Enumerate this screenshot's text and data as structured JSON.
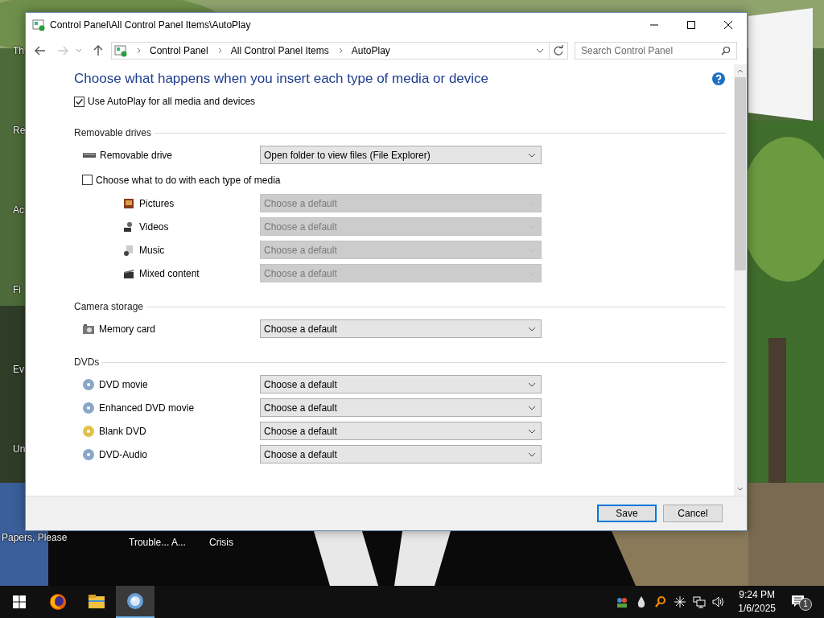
{
  "desktop_icons": [
    {
      "label": "Th"
    },
    {
      "label": "Re"
    },
    {
      "label": "Ac"
    },
    {
      "label": "Fi"
    },
    {
      "label": "Ev"
    },
    {
      "label": "Un"
    },
    {
      "label": "Papers, Please"
    },
    {
      "label": "Trouble... A..."
    },
    {
      "label": "Crisis"
    }
  ],
  "window": {
    "title": "Control Panel\\All Control Panel Items\\AutoPlay"
  },
  "address_bar": {
    "breadcrumbs": [
      "Control Panel",
      "All Control Panel Items",
      "AutoPlay"
    ]
  },
  "search": {
    "placeholder": "Search Control Panel"
  },
  "heading": "Choose what happens when you insert each type of media or device",
  "use_autoplay": {
    "label": "Use AutoPlay for all media and devices",
    "checked": true
  },
  "sections": [
    {
      "title": "Removable drives",
      "items": [
        {
          "kind": "select",
          "label": "Removable drive",
          "value": "Open folder to view files (File Explorer)",
          "disabled": false
        },
        {
          "kind": "checkbox",
          "label": "Choose what to do with each type of media",
          "checked": false,
          "children": [
            {
              "kind": "select",
              "label": "Pictures",
              "value": "Choose a default",
              "disabled": true
            },
            {
              "kind": "select",
              "label": "Videos",
              "value": "Choose a default",
              "disabled": true
            },
            {
              "kind": "select",
              "label": "Music",
              "value": "Choose a default",
              "disabled": true
            },
            {
              "kind": "select",
              "label": "Mixed content",
              "value": "Choose a default",
              "disabled": true
            }
          ]
        }
      ]
    },
    {
      "title": "Camera storage",
      "items": [
        {
          "kind": "select",
          "label": "Memory card",
          "value": "Choose a default",
          "disabled": false
        }
      ]
    },
    {
      "title": "DVDs",
      "items": [
        {
          "kind": "select",
          "label": "DVD movie",
          "value": "Choose a default",
          "disabled": false
        },
        {
          "kind": "select",
          "label": "Enhanced DVD movie",
          "value": "Choose a default",
          "disabled": false
        },
        {
          "kind": "select",
          "label": "Blank DVD",
          "value": "Choose a default",
          "disabled": false
        },
        {
          "kind": "select",
          "label": "DVD-Audio",
          "value": "Choose a default",
          "disabled": false
        }
      ]
    }
  ],
  "buttons": [
    {
      "label": "Save",
      "default": true
    },
    {
      "label": "Cancel",
      "default": false
    }
  ],
  "taskbar": {
    "apps": [
      {
        "selected": false
      },
      {
        "selected": false
      },
      {
        "selected": true
      }
    ],
    "time": "9:24 PM",
    "date": "1/6/2025",
    "notification_count": "1"
  }
}
